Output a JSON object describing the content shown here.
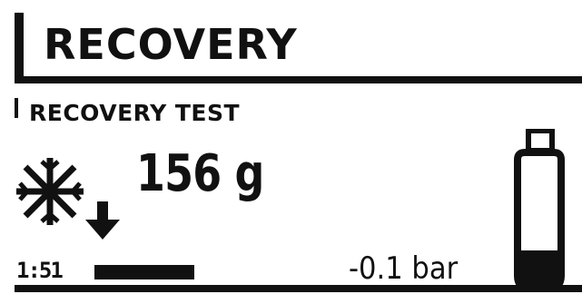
{
  "header": {
    "title": "RECOVERY"
  },
  "section": {
    "subtitle": "RECOVERY TEST"
  },
  "readout": {
    "weight": "156 g",
    "time": "1:51",
    "pressure": "-0.1 bar",
    "progress_fraction": 0.8,
    "cylinder_fill_fraction": 0.28
  },
  "icons": {
    "mode": "snowflake-icon",
    "direction": "down-arrow-icon",
    "tank": "cylinder-icon"
  },
  "colors": {
    "foreground": "#111111",
    "background": "#ffffff"
  }
}
